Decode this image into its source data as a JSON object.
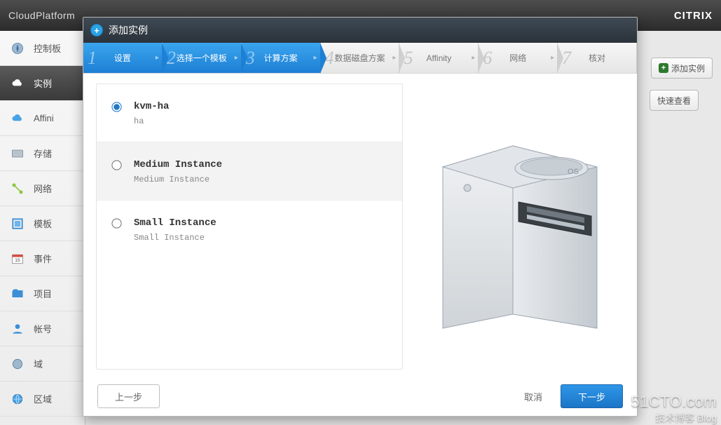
{
  "app": {
    "brand": "CloudPlatform",
    "vendor": "CITRIX"
  },
  "actions": {
    "add_instance": "添加实例",
    "quick_view": "快速查看"
  },
  "sidebar": {
    "items": [
      {
        "label": "控制板"
      },
      {
        "label": "实例"
      },
      {
        "label": "Affini"
      },
      {
        "label": "存储"
      },
      {
        "label": "网络"
      },
      {
        "label": "模板"
      },
      {
        "label": "事件"
      },
      {
        "label": "项目"
      },
      {
        "label": "帐号"
      },
      {
        "label": "域"
      },
      {
        "label": "区域"
      }
    ]
  },
  "modal": {
    "title": "添加实例",
    "steps": [
      {
        "num": "1",
        "label": "设置"
      },
      {
        "num": "2",
        "label": "选择一个模板"
      },
      {
        "num": "3",
        "label": "计算方案"
      },
      {
        "num": "4",
        "label": "数据磁盘方案"
      },
      {
        "num": "5",
        "label": "Affinity"
      },
      {
        "num": "6",
        "label": "网络"
      },
      {
        "num": "7",
        "label": "核对"
      }
    ],
    "options": [
      {
        "title": "kvm-ha",
        "sub": "ha",
        "checked": true
      },
      {
        "title": "Medium Instance",
        "sub": "Medium Instance",
        "checked": false
      },
      {
        "title": "Small Instance",
        "sub": "Small Instance",
        "checked": false
      }
    ],
    "buttons": {
      "prev": "上一步",
      "cancel": "取消",
      "next": "下一步"
    }
  },
  "watermark": {
    "line1": "51CTO.com",
    "line2": "技术博客  Blog"
  }
}
